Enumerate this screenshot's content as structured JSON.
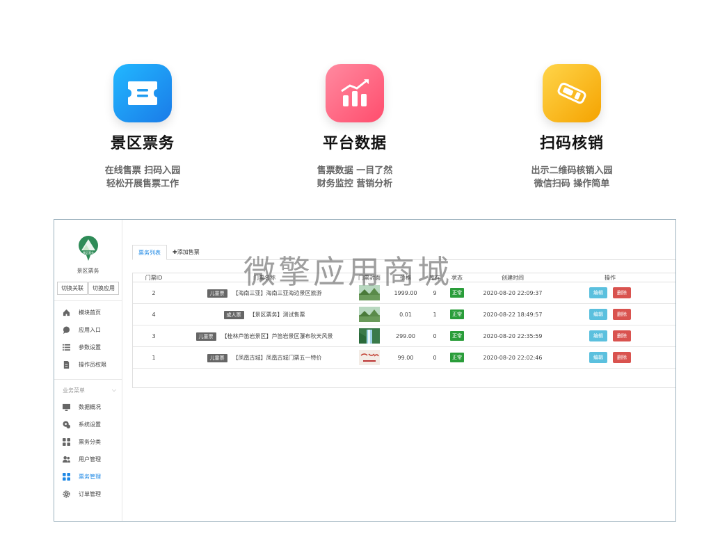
{
  "features": [
    {
      "title": "景区票务",
      "lines": [
        "在线售票 扫码入园",
        "轻松开展售票工作"
      ]
    },
    {
      "title": "平台数据",
      "lines": [
        "售票数据  一目了然",
        "财务监控  营销分析"
      ]
    },
    {
      "title": "扫码核销",
      "lines": [
        "出示二维码核销入园",
        "微信扫码 操作简单"
      ]
    }
  ],
  "watermark": "微擎应用商城",
  "sidebar": {
    "logo_text": "景区票务",
    "app_name": "景区票务",
    "switch_link_label": "切换关联",
    "switch_app_label": "切换应用",
    "top_items": [
      {
        "label": "模块首页",
        "icon": "home-icon"
      },
      {
        "label": "应用入口",
        "icon": "chat-icon"
      },
      {
        "label": "参数设置",
        "icon": "list-icon"
      },
      {
        "label": "操作员权限",
        "icon": "document-icon"
      }
    ],
    "section_label": "业务菜单",
    "section_toggle": "⌵",
    "business_items": [
      {
        "label": "数据概况",
        "icon": "monitor-icon"
      },
      {
        "label": "系统设置",
        "icon": "settings-icon"
      },
      {
        "label": "票务分类",
        "icon": "grid-icon"
      },
      {
        "label": "用户管理",
        "icon": "users-icon"
      },
      {
        "label": "票务管理",
        "icon": "grid-icon",
        "active": true
      },
      {
        "label": "订单管理",
        "icon": "gear-icon"
      }
    ]
  },
  "tabs": [
    {
      "label": "票务列表",
      "active": true
    },
    {
      "label": "✚添加售票",
      "active": false
    }
  ],
  "table": {
    "headers": {
      "id": "门票ID",
      "name": "门票名称",
      "img": "门票封面",
      "price": "价格",
      "stock": "库存",
      "status": "状态",
      "time": "创建时间",
      "op": "操作"
    },
    "rows": [
      {
        "id": "2",
        "category": "儿童票",
        "name": "【海南三亚】海南三亚海边景区旅游",
        "price": "1999.00",
        "stock": "9",
        "status": "正常",
        "time": "2020-08-20 22:09:37",
        "thumb": "landscape"
      },
      {
        "id": "4",
        "category": "成人票",
        "name": "【景区票务】测试售票",
        "price": "0.01",
        "stock": "1",
        "status": "正常",
        "time": "2020-08-22 18:49:57",
        "thumb": "landscape"
      },
      {
        "id": "3",
        "category": "儿童票",
        "name": "【桂林芦笛岩景区】芦笛岩景区瀑布秋天风景",
        "price": "299.00",
        "stock": "0",
        "status": "正常",
        "time": "2020-08-20 22:35:59",
        "thumb": "waterfall"
      },
      {
        "id": "1",
        "category": "儿童票",
        "name": "【凤凰古城】凤凰古城门票五一特价",
        "price": "99.00",
        "stock": "0",
        "status": "正常",
        "time": "2020-08-20 22:02:46",
        "thumb": "calligraphy"
      }
    ],
    "edit_label": "编辑",
    "delete_label": "删除"
  },
  "colors": {
    "feature1": "#1e9bf0",
    "feature2": "#ff5e7a",
    "feature3": "#f7b500",
    "active": "#1e88e5",
    "status_green": "#2a9d3a",
    "edit_blue": "#5bc0de",
    "delete_red": "#d9534f"
  }
}
